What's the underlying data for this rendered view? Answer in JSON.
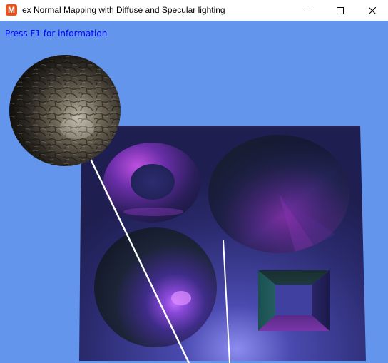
{
  "window": {
    "title": "ex Normal Mapping with Diffuse and Specular lighting",
    "app_icon": "monogame-logo-icon",
    "app_icon_glyph": "M"
  },
  "controls": {
    "minimize_icon": "minimize-icon",
    "maximize_icon": "maximize-icon",
    "close_icon": "close-icon"
  },
  "viewport": {
    "background_color": "#6495ed",
    "info_text": "Press F1 for information"
  },
  "scene": {
    "objects": [
      "stone-texture-sphere",
      "floor-plane",
      "torus",
      "cone-disc",
      "hemisphere-dome",
      "square-pit",
      "light-ray-lines"
    ]
  }
}
